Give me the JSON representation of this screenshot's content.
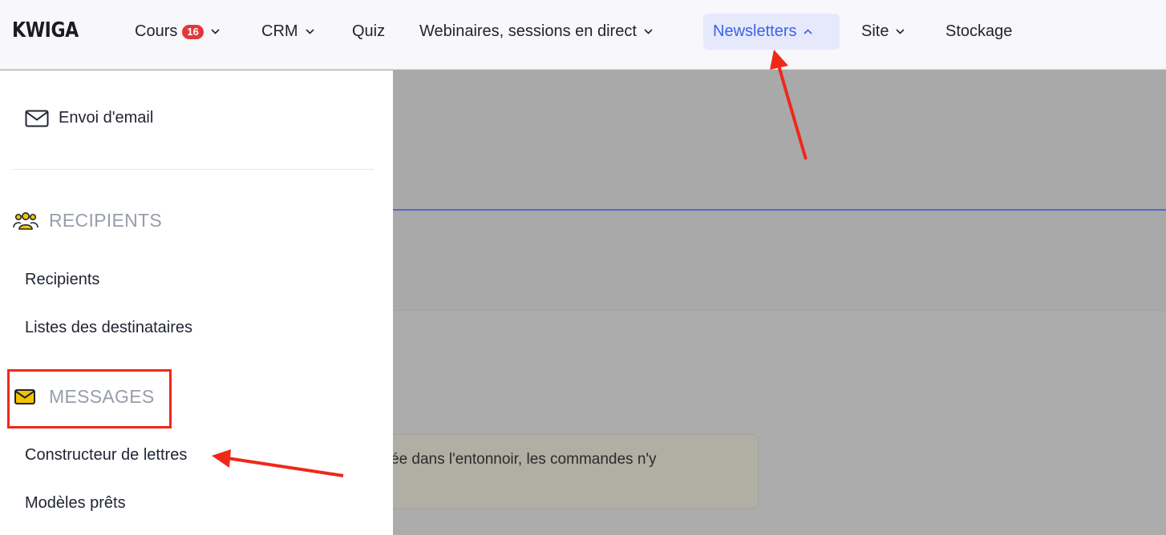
{
  "brand": {
    "logo_text": "KWIGA"
  },
  "nav": {
    "items": [
      {
        "label": "Cours",
        "badge": "16",
        "has_chevron": true
      },
      {
        "label": "CRM",
        "has_chevron": true
      },
      {
        "label": "Quiz",
        "has_chevron": false
      },
      {
        "label": "Webinaires, sessions en direct",
        "has_chevron": true
      },
      {
        "label": "Newsletters",
        "has_chevron": true,
        "active": true,
        "expanded": true
      },
      {
        "label": "Site",
        "has_chevron": true
      },
      {
        "label": "Stockage",
        "has_chevron": false
      }
    ]
  },
  "dropdown": {
    "send_email": {
      "label": "Envoi d'email",
      "icon": "envelope-icon"
    },
    "sections": [
      {
        "title": "RECIPIENTS",
        "icon": "people-icon",
        "links": [
          "Recipients",
          "Listes des destinataires"
        ]
      },
      {
        "title": "MESSAGES",
        "icon": "mail-yellow-icon",
        "links": [
          "Constructeur de lettres",
          "Modèles prêts"
        ]
      }
    ]
  },
  "background": {
    "notice_text": "tivée dans l'entonnoir, les commandes n'y"
  },
  "colors": {
    "accent": "#3a63e8",
    "badge": "#e03838",
    "annotation": "#f0281a",
    "section_title": "#979dab",
    "icon_yellow": "#f5c400"
  }
}
